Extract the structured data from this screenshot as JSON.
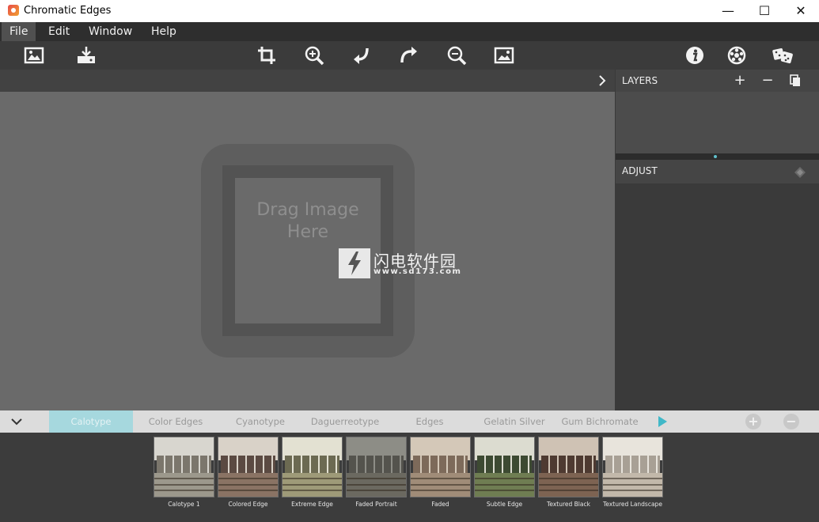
{
  "window": {
    "title": "Chromatic Edges",
    "controls": {
      "minimize": "—",
      "maximize": "☐",
      "close": "✕"
    }
  },
  "menu": {
    "items": [
      {
        "label": "File",
        "active": true
      },
      {
        "label": "Edit"
      },
      {
        "label": "Window"
      },
      {
        "label": "Help"
      }
    ]
  },
  "toolbar": {
    "left": [
      "open-image-icon",
      "save-export-icon"
    ],
    "center": [
      "crop-icon",
      "zoom-in-icon",
      "undo-icon",
      "redo-icon",
      "zoom-out-icon",
      "fit-image-icon"
    ],
    "right": [
      "info-icon",
      "settings-icon",
      "random-dice-icon"
    ]
  },
  "canvas": {
    "drop_line1": "Drag Image",
    "drop_line2": "Here",
    "watermark_cn": "闪电软件园",
    "watermark_url": "www.sd173.com"
  },
  "layers": {
    "title": "LAYERS",
    "add": "+",
    "remove": "−",
    "duplicate_icon": "duplicate-icon"
  },
  "adjust": {
    "title": "ADJUST",
    "icon": "eraser-icon"
  },
  "presets": {
    "categories": [
      {
        "label": "Calotype",
        "active": true
      },
      {
        "label": "Color Edges"
      },
      {
        "label": "Cyanotype"
      },
      {
        "label": "Daguerreotype"
      },
      {
        "label": "Edges"
      },
      {
        "label": "Gelatin Silver"
      },
      {
        "label": "Gum Bichromate"
      }
    ],
    "add": "+",
    "remove": "−",
    "thumbnails": [
      {
        "label": "Calotype 1",
        "sky": "#d8d6cf",
        "train": "#7b766c",
        "ground": "#9c988c"
      },
      {
        "label": "Colored Edge",
        "sky": "#d9d2c8",
        "train": "#5b4a42",
        "ground": "#8a7364"
      },
      {
        "label": "Extreme Edge",
        "sky": "#e3e1d2",
        "train": "#6c6a52",
        "ground": "#9e9a78"
      },
      {
        "label": "Faded Portrait",
        "sky": "#8d8d86",
        "train": "#54534d",
        "ground": "#6b6960"
      },
      {
        "label": "Faded",
        "sky": "#d4c8b8",
        "train": "#7d6a5a",
        "ground": "#a08c78"
      },
      {
        "label": "Subtle Edge",
        "sky": "#dcdcd0",
        "train": "#3d4a32",
        "ground": "#6f7d52"
      },
      {
        "label": "Textured Black",
        "sky": "#cfc2b4",
        "train": "#4e3a31",
        "ground": "#7d6352"
      },
      {
        "label": "Textured Landscape",
        "sky": "#e8e4dc",
        "train": "#a8a095",
        "ground": "#c2b8aa"
      }
    ]
  },
  "colors": {
    "accent": "#40b8c8",
    "active_tab": "#a6d8de",
    "canvas": "#6a6a6a",
    "panel": "#3a3a3a"
  }
}
